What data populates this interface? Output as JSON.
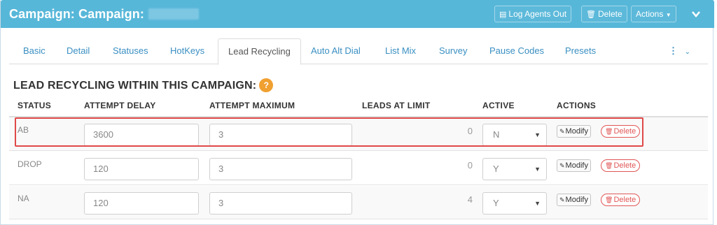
{
  "header": {
    "title": "Campaign: Campaign:",
    "log_agents_out": "Log Agents Out",
    "delete": "Delete",
    "actions": "Actions",
    "accent": "#57b7d9"
  },
  "tabs": [
    {
      "label": "Basic"
    },
    {
      "label": "Detail"
    },
    {
      "label": "Statuses"
    },
    {
      "label": "HotKeys"
    },
    {
      "label": "Lead Recycling"
    },
    {
      "label": "Auto Alt Dial"
    },
    {
      "label": "List Mix"
    },
    {
      "label": "Survey"
    },
    {
      "label": "Pause Codes"
    },
    {
      "label": "Presets"
    }
  ],
  "section": {
    "title": "LEAD RECYCLING WITHIN THIS CAMPAIGN:",
    "help": "?"
  },
  "table": {
    "columns": [
      "STATUS",
      "ATTEMPT DELAY",
      "ATTEMPT MAXIMUM",
      "LEADS AT LIMIT",
      "ACTIVE",
      "ACTIONS"
    ],
    "rows": [
      {
        "status": "AB",
        "attempt_delay": "3600",
        "attempt_maximum": "3",
        "leads_at_limit": "0",
        "active": "N"
      },
      {
        "status": "DROP",
        "attempt_delay": "120",
        "attempt_maximum": "3",
        "leads_at_limit": "0",
        "active": "Y"
      },
      {
        "status": "NA",
        "attempt_delay": "120",
        "attempt_maximum": "3",
        "leads_at_limit": "4",
        "active": "Y"
      }
    ],
    "modify_label": "Modify",
    "delete_label": "Delete"
  }
}
